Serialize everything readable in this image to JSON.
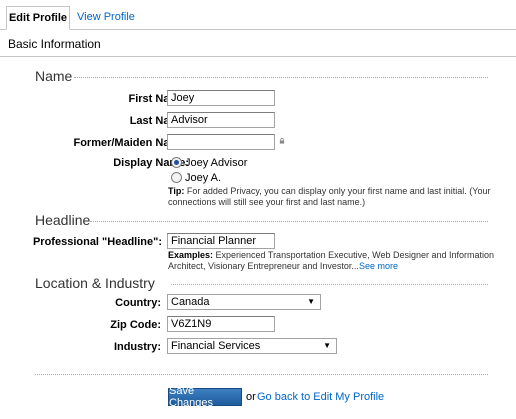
{
  "tabs": {
    "edit_profile": "Edit Profile",
    "view_profile": "View Profile"
  },
  "basic_information": "Basic Information",
  "name_section": {
    "title": "Name",
    "first_name_label": "First Name:",
    "first_name_value": "Joey",
    "last_name_label": "Last Name:",
    "last_name_value": "Advisor",
    "former_name_label": "Former/Maiden Name:",
    "former_name_value": "",
    "display_name_label": "Display Name:",
    "display_options": [
      "Joey Advisor",
      "Joey A."
    ],
    "display_selected": "Joey Advisor",
    "tip_label": "Tip:",
    "tip_text": " For added Privacy, you can display only your first name and last initial. (Your connections will still see your first and last name.)"
  },
  "headline_section": {
    "title": "Headline",
    "label": "Professional \"Headline\":",
    "value": "Financial Planner",
    "examples_label": "Examples:",
    "examples_text": " Experienced Transportation Executive, Web Designer and Information Architect, Visionary Entrepreneur and Investor...",
    "see_more": "See more"
  },
  "location_section": {
    "title": "Location & Industry",
    "country_label": "Country:",
    "country_value": "Canada",
    "zip_label": "Zip Code:",
    "zip_value": "V6Z1N9",
    "industry_label": "Industry:",
    "industry_value": "Financial Services"
  },
  "footer": {
    "save_label": "Save Changes",
    "or_text": "or",
    "back_link": "Go back to Edit My Profile"
  },
  "colors": {
    "link": "#0066cc",
    "button": "#2a6cad",
    "border": "#c5c5c5"
  },
  "icons": [
    "lock-icon",
    "dropdown-arrow-icon"
  ]
}
